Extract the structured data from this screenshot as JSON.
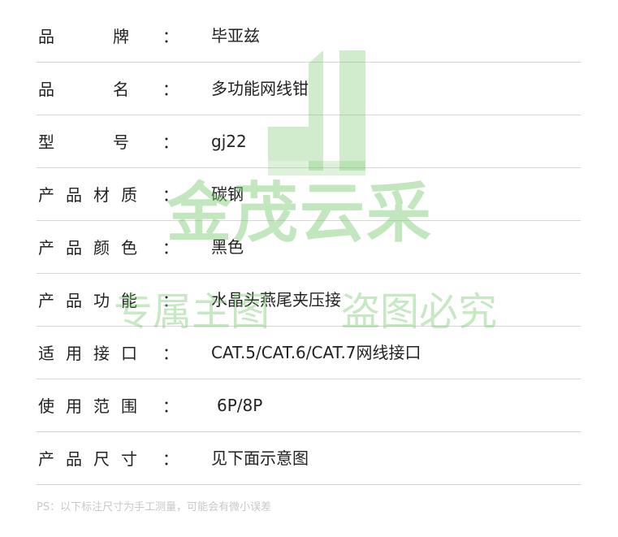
{
  "specs": [
    {
      "label": [
        "品",
        "牌"
      ],
      "value": "毕亚兹"
    },
    {
      "label": [
        "品",
        "名"
      ],
      "value": "多功能网线钳"
    },
    {
      "label": [
        "型",
        "号"
      ],
      "value": "gj22"
    },
    {
      "label": [
        "产",
        "品",
        "材",
        "质"
      ],
      "value": "碳钢"
    },
    {
      "label": [
        "产",
        "品",
        "颜",
        "色"
      ],
      "value": "黑色"
    },
    {
      "label": [
        "产",
        "品",
        "功",
        "能"
      ],
      "value": "水晶头燕尾夹压接"
    },
    {
      "label": [
        "适",
        "用",
        "接",
        "口"
      ],
      "value": "CAT.5/CAT.6/CAT.7网线接口"
    },
    {
      "label": [
        "使",
        "用",
        "范",
        "围"
      ],
      "value": "6P/8P"
    },
    {
      "label": [
        "产",
        "品",
        "尺",
        "寸"
      ],
      "value": "见下面示意图"
    }
  ],
  "colon": "：",
  "footnote": "PS：以下标注尺寸为手工测量，可能会有微小误差",
  "watermark": {
    "brand": "金茂云采",
    "slogan_left": "专属主图",
    "slogan_right": "盗图必究",
    "color": "#78c86e"
  }
}
